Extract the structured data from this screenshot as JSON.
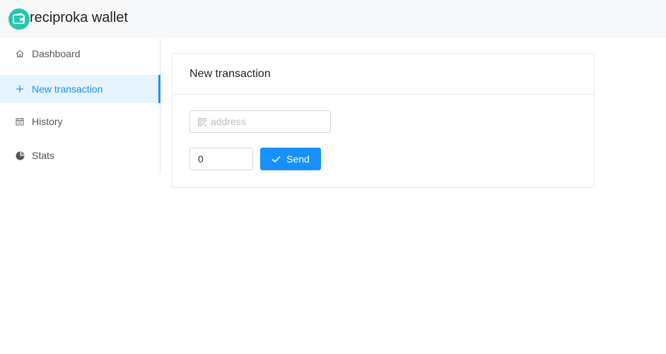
{
  "app": {
    "title": "reciproka wallet",
    "icon": "wallet-icon",
    "brand_color": "#24c7b0"
  },
  "sidebar": {
    "items": [
      {
        "label": "Dashboard",
        "icon": "home-icon",
        "active": false
      },
      {
        "label": "New transaction",
        "icon": "plus-icon",
        "active": true
      },
      {
        "label": "History",
        "icon": "calendar-icon",
        "active": false
      },
      {
        "label": "Stats",
        "icon": "pie-chart-icon",
        "active": false
      }
    ]
  },
  "card": {
    "title": "New transaction",
    "address": {
      "placeholder": "address",
      "value": "",
      "icon": "qrcode-icon"
    },
    "amount": {
      "value": "0"
    },
    "send_button": {
      "label": "Send",
      "icon": "check-icon"
    }
  },
  "colors": {
    "accent": "#1890ff",
    "active_bg": "#e6f4fd",
    "header_bg": "#f7f8f9"
  }
}
